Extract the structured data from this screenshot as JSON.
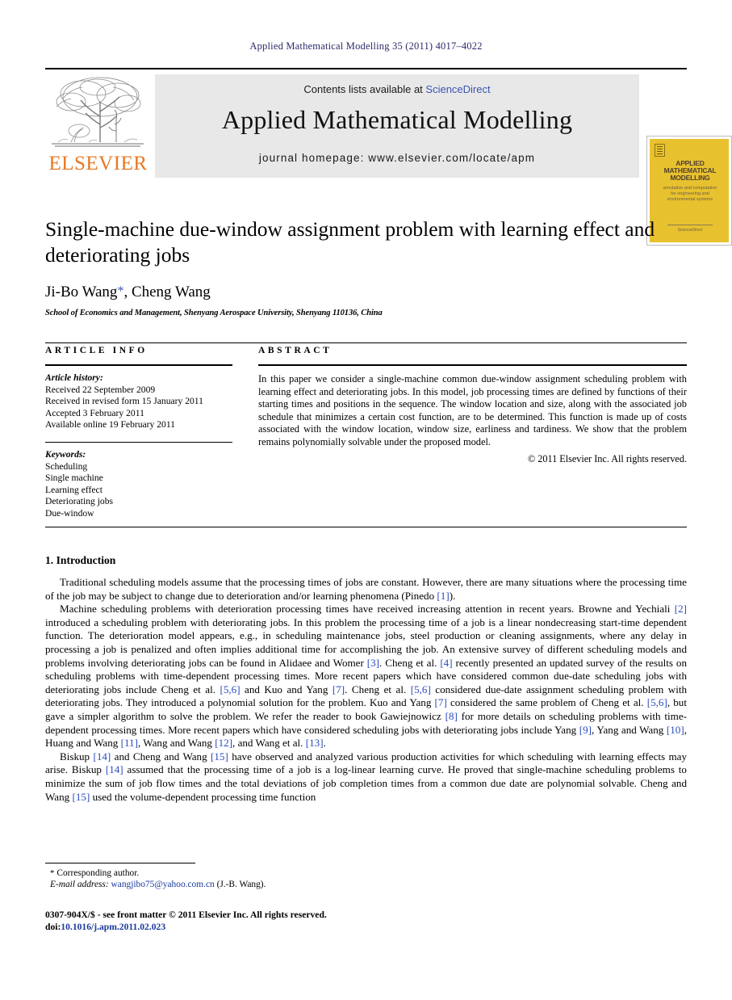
{
  "running_head": "Applied Mathematical Modelling 35 (2011) 4017–4022",
  "masthead": {
    "contents_prefix": "Contents lists available at ",
    "sciencedirect": "ScienceDirect",
    "journal_title": "Applied Mathematical Modelling",
    "homepage": "journal homepage: www.elsevier.com/locate/apm",
    "publisher_name": "ELSEVIER",
    "cover": {
      "title": "APPLIED MATHEMATICAL MODELLING",
      "subtitle": "simulation and computation for engineering and environmental systems",
      "footer": "ScienceDirect"
    }
  },
  "title_block": {
    "title": "Single-machine due-window assignment problem with learning effect and deteriorating jobs",
    "authors": "Ji-Bo Wang",
    "corresponding_marker": "*",
    "authors_rest": ", Cheng Wang",
    "affiliation": "School of Economics and Management, Shenyang Aerospace University, Shenyang 110136, China"
  },
  "article_info": {
    "heading": "ARTICLE INFO",
    "history_label": "Article history:",
    "history": [
      "Received 22 September 2009",
      "Received in revised form 15 January 2011",
      "Accepted 3 February 2011",
      "Available online 19 February 2011"
    ],
    "keywords_label": "Keywords:",
    "keywords": [
      "Scheduling",
      "Single machine",
      "Learning effect",
      "Deteriorating jobs",
      "Due-window"
    ]
  },
  "abstract": {
    "heading": "ABSTRACT",
    "text": "In this paper we consider a single-machine common due-window assignment scheduling problem with learning effect and deteriorating jobs. In this model, job processing times are defined by functions of their starting times and positions in the sequence. The window location and size, along with the associated job schedule that minimizes a certain cost function, are to be determined. This function is made up of costs associated with the window location, window size, earliness and tardiness. We show that the problem remains polynomially solvable under the proposed model.",
    "copyright": "© 2011 Elsevier Inc. All rights reserved."
  },
  "body": {
    "section_number_title": "1. Introduction",
    "paragraphs": [
      "Traditional scheduling models assume that the processing times of jobs are constant. However, there are many situations where the processing time of the job may be subject to change due to deterioration and/or learning phenomena (Pinedo [1]).",
      "Machine scheduling problems with deterioration processing times have received increasing attention in recent years. Browne and Yechiali [2] introduced a scheduling problem with deteriorating jobs. In this problem the processing time of a job is a linear nondecreasing start-time dependent function. The deterioration model appears, e.g., in scheduling maintenance jobs, steel production or cleaning assignments, where any delay in processing a job is penalized and often implies additional time for accomplishing the job. An extensive survey of different scheduling models and problems involving deteriorating jobs can be found in Alidaee and Womer [3]. Cheng et al. [4] recently presented an updated survey of the results on scheduling problems with time-dependent processing times. More recent papers which have considered common due-date scheduling jobs with deteriorating jobs include Cheng et al. [5,6] and Kuo and Yang [7]. Cheng et al. [5,6] considered due-date assignment scheduling problem with deteriorating jobs. They introduced a polynomial solution for the problem. Kuo and Yang [7] considered the same problem of Cheng et al. [5,6], but gave a simpler algorithm to solve the problem. We refer the reader to book Gawiejnowicz [8] for more details on scheduling problems with time-dependent processing times. More recent papers which have considered scheduling jobs with deteriorating jobs include Yang [9], Yang and Wang [10], Huang and Wang [11], Wang and Wang [12], and Wang et al. [13].",
      "Biskup [14] and Cheng and Wang [15] have observed and analyzed various production activities for which scheduling with learning effects may arise. Biskup [14] assumed that the processing time of a job is a log-linear learning curve. He proved that single-machine scheduling problems to minimize the sum of job flow times and the total deviations of job completion times from a common due date are polynomial solvable. Cheng and Wang [15] used the volume-dependent processing time function"
    ]
  },
  "footnote": {
    "marker": "*",
    "corresponding": "Corresponding author.",
    "email_label": "E-mail address:",
    "email": "wangjibo75@yahoo.com.cn",
    "email_owner": "(J.-B. Wang)."
  },
  "imprint": {
    "line1": "0307-904X/$ - see front matter © 2011 Elsevier Inc. All rights reserved.",
    "doi_label": "doi:",
    "doi_value": "10.1016/j.apm.2011.02.023"
  },
  "colors": {
    "link_blue": "#2b4bbd",
    "elsevier_orange": "#E87722",
    "cover_gold": "#E8C12E"
  }
}
